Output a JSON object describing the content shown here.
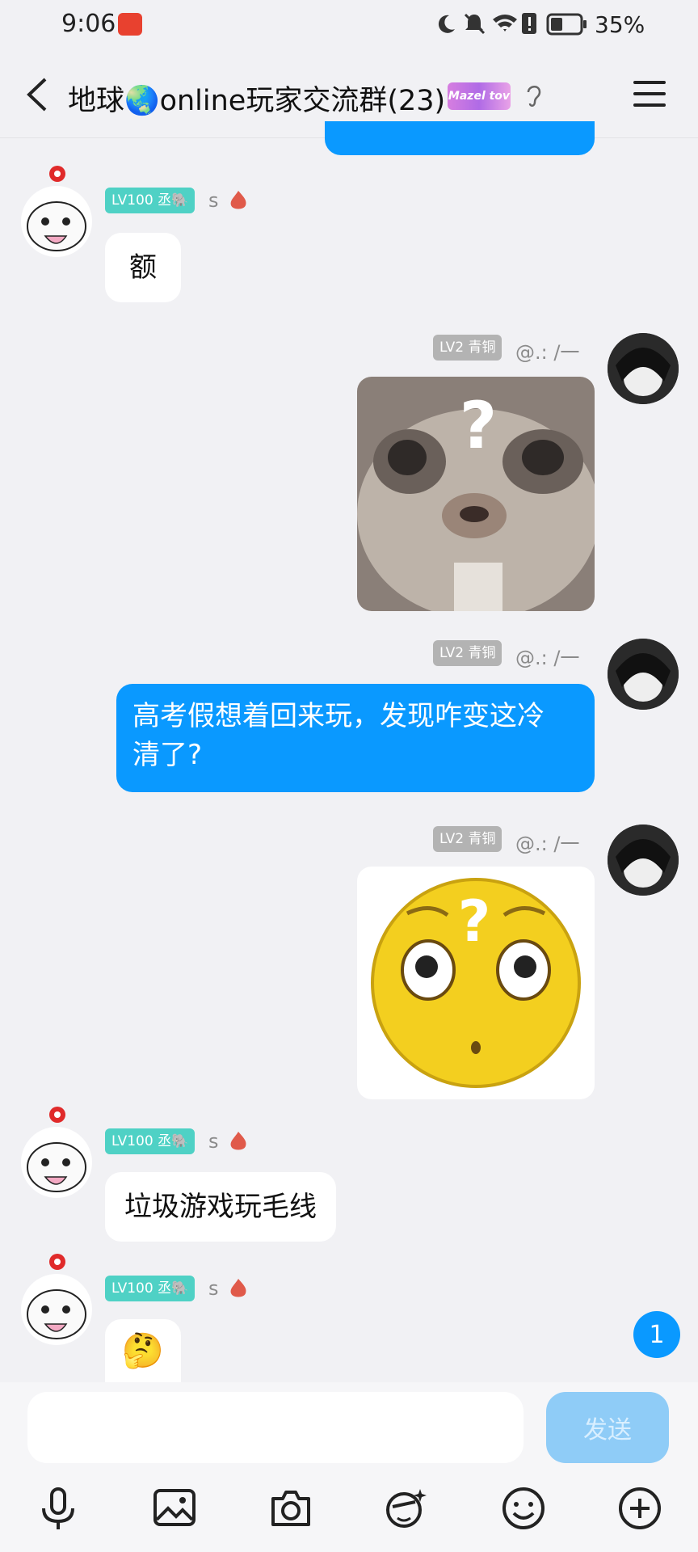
{
  "status_bar": {
    "time": "9:06",
    "battery": "35%"
  },
  "header": {
    "title": "地球🌏online玩家交流群(23)",
    "badge": "Mazel tov"
  },
  "messages": [
    {
      "level": "LV100 丞🐘",
      "name": "s",
      "text": "额"
    },
    {
      "level": "LV2 青铜",
      "name": "@.: /一"
    },
    {
      "level": "LV2 青铜",
      "name": "@.: /一",
      "text_line1": "高考假想着回来玩，发现咋变这冷",
      "text_line2": "清了?"
    },
    {
      "level": "LV2 青铜",
      "name": "@.: /一"
    },
    {
      "level": "LV100 丞🐘",
      "name": "s",
      "text": "垃圾游戏玩毛线"
    },
    {
      "level": "LV100 丞🐘",
      "name": "s",
      "text": "🤔"
    }
  ],
  "unread_count": "1",
  "input": {
    "placeholder": "",
    "send_label": "发送"
  },
  "colors": {
    "accent": "#0a99ff",
    "level_green": "#4fd1c5",
    "level_gray": "#b3b3b3"
  }
}
